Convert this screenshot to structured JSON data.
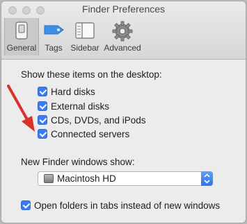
{
  "window": {
    "title": "Finder Preferences"
  },
  "toolbar": {
    "tabs": [
      {
        "label": "General"
      },
      {
        "label": "Tags"
      },
      {
        "label": "Sidebar"
      },
      {
        "label": "Advanced"
      }
    ]
  },
  "desktop": {
    "heading": "Show these items on the desktop:",
    "items": [
      {
        "label": "Hard disks",
        "checked": true
      },
      {
        "label": "External disks",
        "checked": true
      },
      {
        "label": "CDs, DVDs, and iPods",
        "checked": true
      },
      {
        "label": "Connected servers",
        "checked": true
      }
    ]
  },
  "new_window": {
    "heading": "New Finder windows show:",
    "selected": "Macintosh HD"
  },
  "tabs_option": {
    "label": "Open folders in tabs instead of new windows",
    "checked": true
  },
  "colors": {
    "accent": "#3a7cf2",
    "annotation_arrow": "#d9322b"
  }
}
